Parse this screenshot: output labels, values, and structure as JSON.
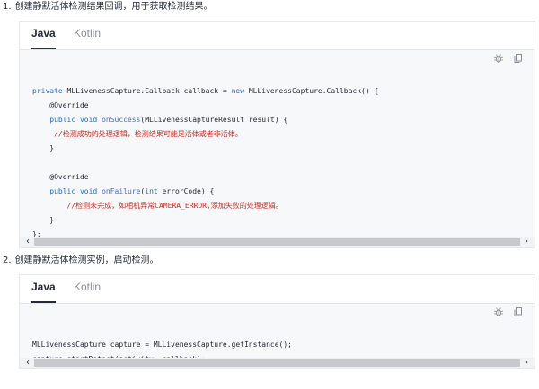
{
  "steps": [
    {
      "number": "1.",
      "title": "创建静默活体检测结果回调，用于获取检测结果。",
      "tabs": [
        {
          "label": "Java"
        },
        {
          "label": "Kotlin"
        }
      ],
      "active_tab": "Java",
      "icons": {
        "bug": "bug-icon",
        "copy": "copy-icon"
      },
      "code": [
        [
          {
            "t": "private ",
            "c": "kw"
          },
          {
            "t": "MLLivenessCapture.Callback callback = "
          },
          {
            "t": "new ",
            "c": "kw"
          },
          {
            "t": "MLLivenessCapture.Callback() {"
          }
        ],
        [
          {
            "t": "    @Override"
          }
        ],
        [
          {
            "t": "    "
          },
          {
            "t": "public void ",
            "c": "kw"
          },
          {
            "t": "onSuccess",
            "c": "fn"
          },
          {
            "t": "(MLLivenessCaptureResult result) {"
          }
        ],
        [
          {
            "t": "     "
          },
          {
            "t": "//检测成功的处理逻辑，检测结果可能是活体或者非活体。",
            "c": "cm"
          }
        ],
        [
          {
            "t": "    }"
          }
        ],
        [
          {
            "t": ""
          }
        ],
        [
          {
            "t": "    @Override"
          }
        ],
        [
          {
            "t": "    "
          },
          {
            "t": "public void ",
            "c": "kw"
          },
          {
            "t": "onFailure",
            "c": "fn"
          },
          {
            "t": "("
          },
          {
            "t": "int ",
            "c": "kw"
          },
          {
            "t": "errorCode) {"
          }
        ],
        [
          {
            "t": "        "
          },
          {
            "t": "//检测未完成，如相机异常CAMERA_ERROR,添加失败的处理逻辑。",
            "c": "cm"
          }
        ],
        [
          {
            "t": "    }"
          }
        ],
        [
          {
            "t": "};"
          }
        ]
      ],
      "scroll": {
        "left_arrow": "‹",
        "right_arrow": "›"
      }
    },
    {
      "number": "2.",
      "title": "创建静默活体检测实例，启动检测。",
      "tabs": [
        {
          "label": "Java"
        },
        {
          "label": "Kotlin"
        }
      ],
      "active_tab": "Java",
      "icons": {
        "bug": "bug-icon",
        "copy": "copy-icon"
      },
      "code": [
        [
          {
            "t": "MLLivenessCapture capture = MLLivenessCapture.getInstance();"
          }
        ],
        [
          {
            "t": "capture.startDetect(activity, callback);"
          }
        ]
      ],
      "scroll": {
        "left_arrow": "‹",
        "right_arrow": "›"
      }
    }
  ],
  "colors": {
    "keyword": "#1a6ae0",
    "function": "#4e6ad8",
    "comment": "#d4281f",
    "text": "#252b3a",
    "code_bg": "#f7f8fa"
  }
}
